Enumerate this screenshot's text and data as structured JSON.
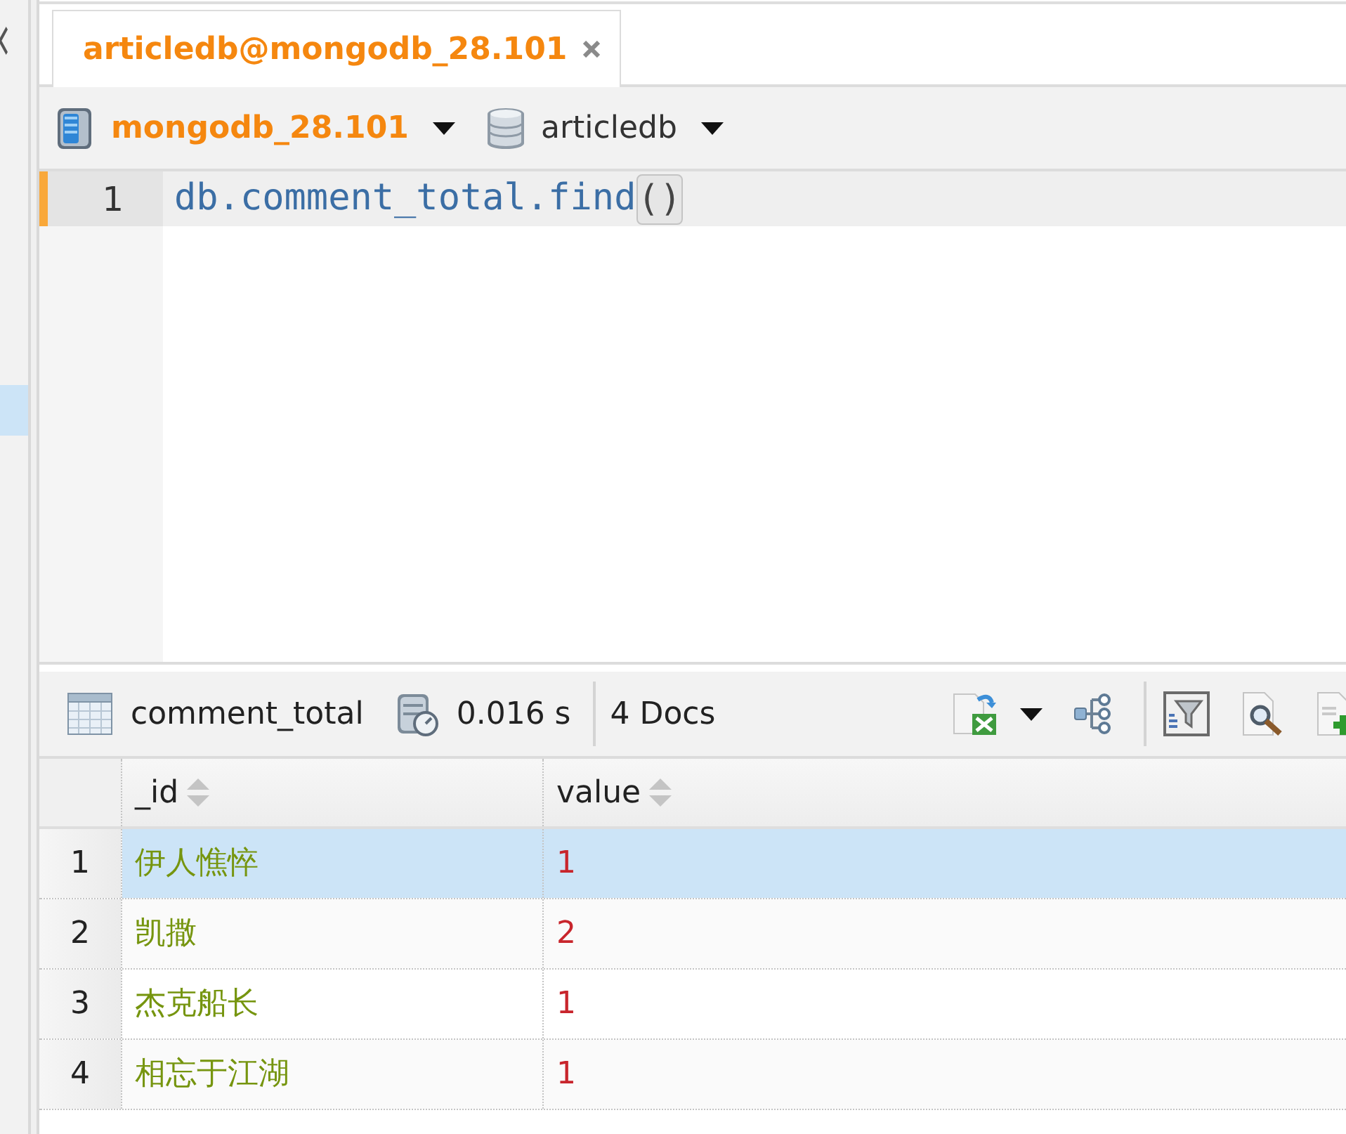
{
  "side_panel": {
    "selection_visible": true
  },
  "tabs": [
    {
      "label": "articledb@mongodb_28.101",
      "selected": true,
      "closable": true
    }
  ],
  "connection_bar": {
    "connection": "mongodb_28.101",
    "database": "articledb"
  },
  "editor": {
    "lines": [
      {
        "number": "1",
        "current": true,
        "tokens": [
          {
            "kind": "code",
            "text": "db.comment_total.find"
          },
          {
            "kind": "bracket_match",
            "text": "()"
          }
        ]
      }
    ]
  },
  "results_bar": {
    "collection": "comment_total",
    "time": "0.016 s",
    "count": "4 Docs"
  },
  "table": {
    "columns": [
      {
        "label": "_id",
        "kind": "string"
      },
      {
        "label": "value",
        "kind": "number"
      }
    ],
    "rows": [
      {
        "number": "1",
        "selected": true,
        "cells": [
          "伊人憔悴",
          "1"
        ]
      },
      {
        "number": "2",
        "selected": false,
        "cells": [
          "凯撒",
          "2"
        ]
      },
      {
        "number": "3",
        "selected": false,
        "cells": [
          "杰克船长",
          "1"
        ]
      },
      {
        "number": "4",
        "selected": false,
        "cells": [
          "相忘于江湖",
          "1"
        ]
      }
    ]
  }
}
